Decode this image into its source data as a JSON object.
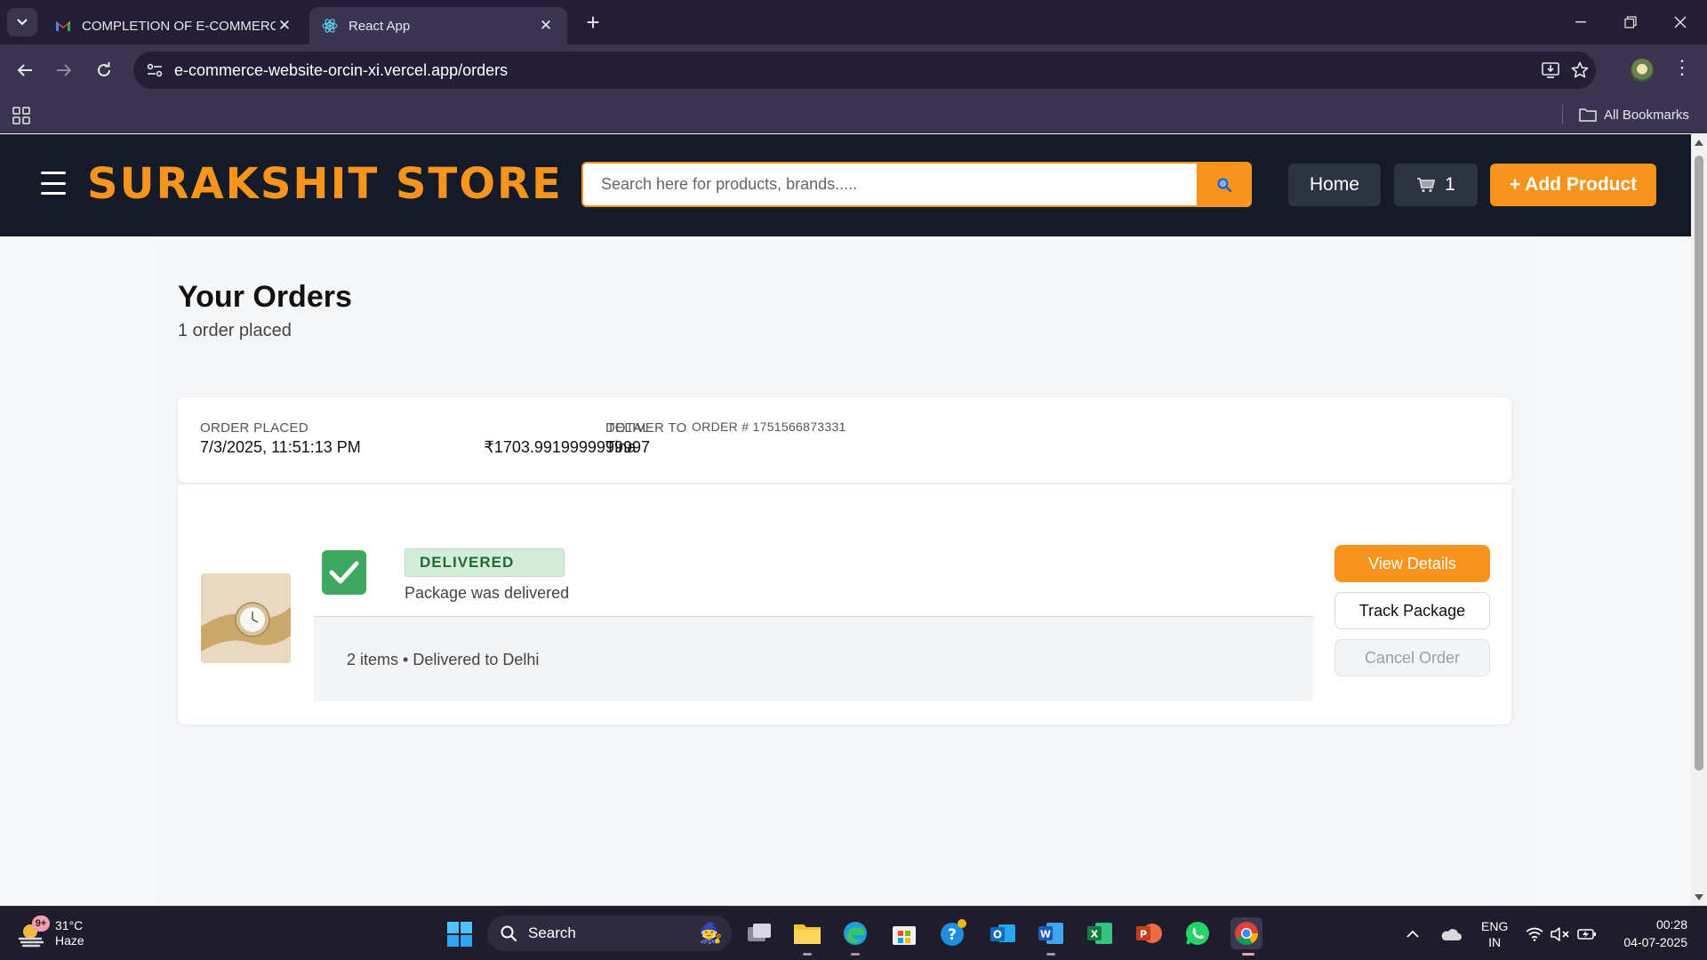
{
  "browser": {
    "tabs": [
      {
        "title": "COMPLETION OF E-COMMERCE",
        "favicon": "gmail-icon",
        "active": false
      },
      {
        "title": "React App",
        "favicon": "react-icon",
        "active": true
      }
    ],
    "url": "e-commerce-website-orcin-xi.vercel.app/orders",
    "bookmarks_label": "All Bookmarks"
  },
  "header": {
    "brand": "SURAKSHIT STORE",
    "search_placeholder": "Search here for products, brands.....",
    "home_label": "Home",
    "cart_count": "1",
    "add_product_label": "+ Add Product",
    "accent_color": "#f7941d"
  },
  "page": {
    "title": "Your Orders",
    "subtitle": "1 order placed"
  },
  "order": {
    "placed_label": "ORDER PLACED",
    "placed_value": "7/3/2025, 11:51:13 PM",
    "total_label": "TOTAL",
    "total_value": "₹1703.9919999999997",
    "deliver_label": "DELIVER TO",
    "deliver_value": "Tina",
    "order_number": "ORDER # 1751566873331",
    "status": "DELIVERED",
    "status_note": "Package was delivered",
    "summary": "2 items • Delivered to Delhi",
    "actions": {
      "view": "View Details",
      "track": "Track Package",
      "cancel": "Cancel Order"
    }
  },
  "taskbar": {
    "temperature": "31°C",
    "condition": "Haze",
    "notif_count": "9+",
    "search_label": "Search",
    "lang_top": "ENG",
    "lang_bottom": "IN",
    "time": "00:28",
    "date": "04-07-2025"
  }
}
